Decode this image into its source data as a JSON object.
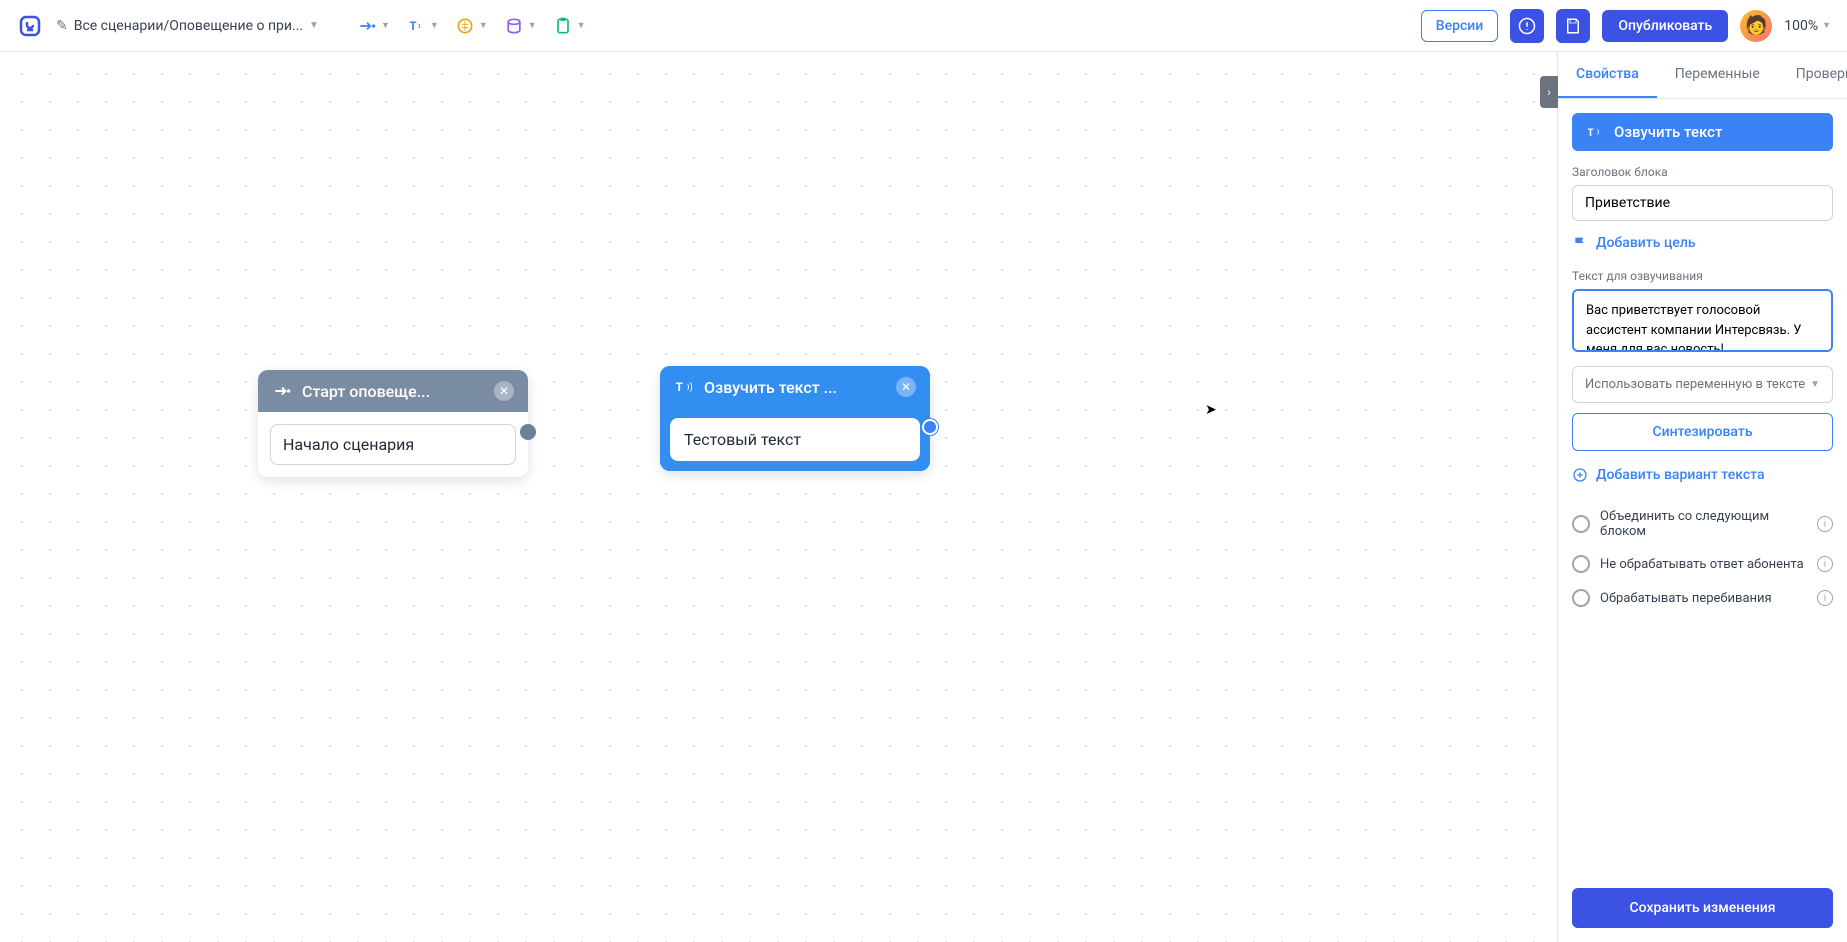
{
  "header": {
    "breadcrumb": "Все сценарии/Оповещение о при...",
    "versions_btn": "Версии",
    "publish_btn": "Опубликовать",
    "zoom": "100%"
  },
  "canvas": {
    "node1": {
      "title": "Старт оповеще...",
      "value": "Начало сценария"
    },
    "node2": {
      "title": "Озвучить текст ...",
      "value": "Тестовый текст"
    }
  },
  "sidepanel": {
    "tabs": {
      "properties": "Свойства",
      "variables": "Переменные",
      "check": "Проверка"
    },
    "block_type": "Озвучить текст",
    "title_label": "Заголовок блока",
    "title_value": "Приветствие",
    "add_goal": "Добавить цель",
    "tts_label": "Текст для озвучивания",
    "tts_text": "Вас приветствует голосовой ассистент компании Интерсвязь. У меня для вас новость!",
    "use_var": "Использовать переменную в тексте",
    "synthesize": "Синтезировать",
    "add_variant": "Добавить вариант текста",
    "opt_merge": "Объединить со следующим блоком",
    "opt_no_process": "Не обрабатывать ответ абонента",
    "opt_interrupt": "Обрабатывать перебивания",
    "save_btn": "Сохранить изменения"
  }
}
